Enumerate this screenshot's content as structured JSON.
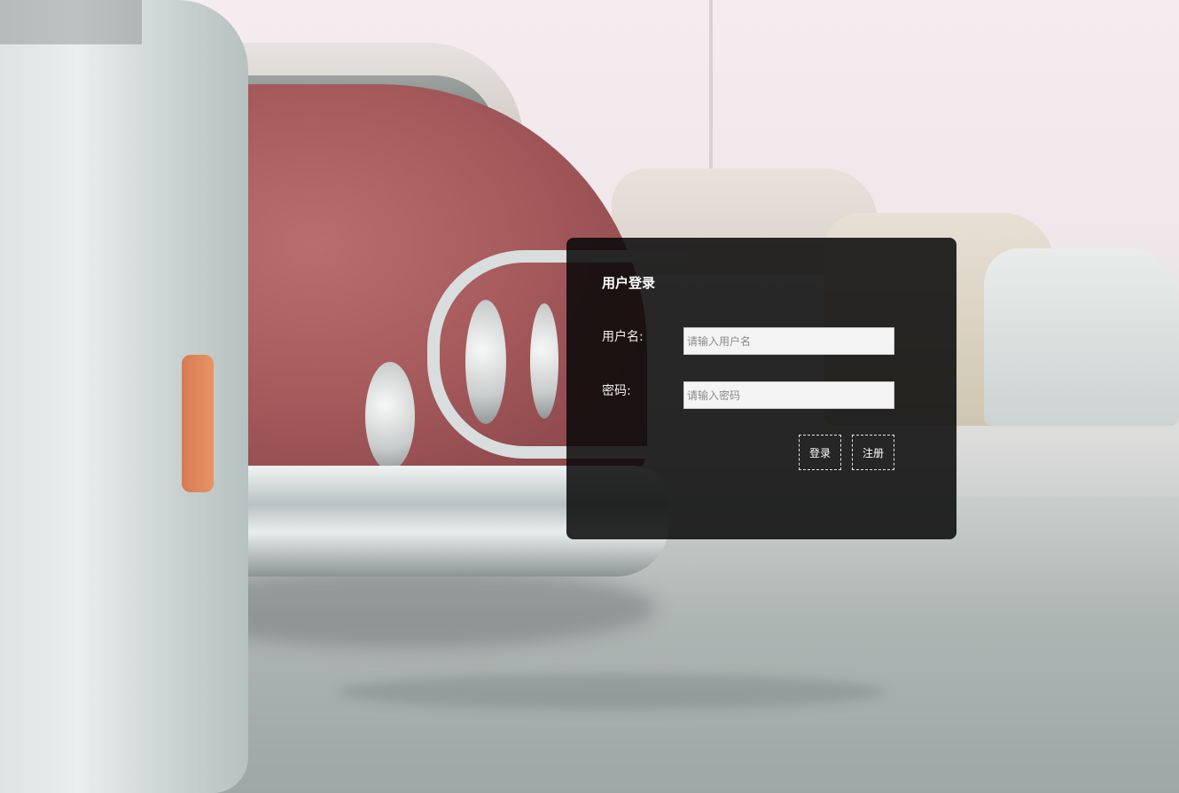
{
  "login": {
    "title": "用户登录",
    "username": {
      "label": "用户名:",
      "placeholder": "请输入用户名",
      "value": ""
    },
    "password": {
      "label": "密码:",
      "placeholder": "请输入密码",
      "value": ""
    },
    "buttons": {
      "login_label": "登录",
      "register_label": "注册"
    }
  },
  "colors": {
    "panel_background": "#080808",
    "panel_text": "#ffffff",
    "input_background": "#f4f4f4"
  }
}
